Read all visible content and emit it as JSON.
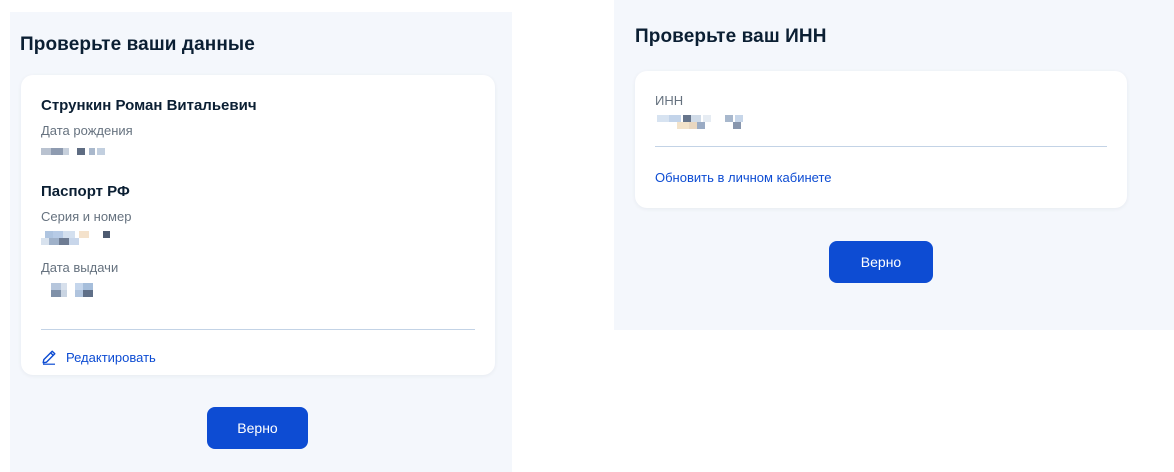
{
  "left": {
    "title": "Проверьте ваши данные",
    "full_name": "Стрункин Роман Витальевич",
    "birth_label": "Дата рождения",
    "passport_section": "Паспорт РФ",
    "series_label": "Серия и номер",
    "issue_label": "Дата выдачи",
    "edit_label": "Редактировать",
    "confirm_label": "Верно"
  },
  "right": {
    "title": "Проверьте ваш ИНН",
    "inn_label": "ИНН",
    "update_link": "Обновить в личном кабинете",
    "confirm_label": "Верно"
  },
  "colors": {
    "accent": "#0d4cd3",
    "panel_bg": "#f4f7fc",
    "text": "#0b1f33",
    "muted": "#66727f",
    "divider": "#c3d3e6"
  },
  "icons": {
    "edit": "pencil-icon"
  }
}
